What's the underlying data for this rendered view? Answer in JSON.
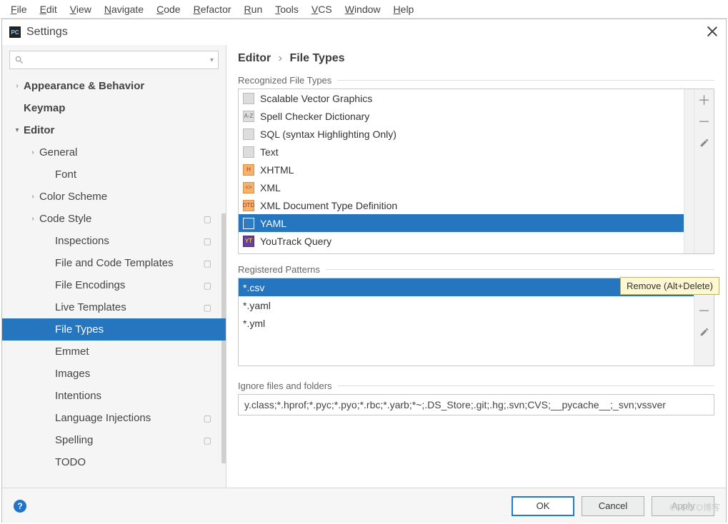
{
  "menubar": [
    "File",
    "Edit",
    "View",
    "Navigate",
    "Code",
    "Refactor",
    "Run",
    "Tools",
    "VCS",
    "Window",
    "Help"
  ],
  "dialog": {
    "title": "Settings"
  },
  "search": {
    "placeholder": ""
  },
  "tree": [
    {
      "label": "Appearance & Behavior",
      "bold": true,
      "arrow": "right",
      "indent": 0
    },
    {
      "label": "Keymap",
      "bold": true,
      "indent": 0,
      "noarrow": true
    },
    {
      "label": "Editor",
      "bold": true,
      "arrow": "down",
      "indent": 0
    },
    {
      "label": "General",
      "arrow": "right",
      "indent": 1
    },
    {
      "label": "Font",
      "indent": 2,
      "noarrow": true
    },
    {
      "label": "Color Scheme",
      "arrow": "right",
      "indent": 1
    },
    {
      "label": "Code Style",
      "arrow": "right",
      "indent": 1,
      "mark": true
    },
    {
      "label": "Inspections",
      "indent": 2,
      "noarrow": true,
      "mark": true
    },
    {
      "label": "File and Code Templates",
      "indent": 2,
      "noarrow": true,
      "mark": true
    },
    {
      "label": "File Encodings",
      "indent": 2,
      "noarrow": true,
      "mark": true
    },
    {
      "label": "Live Templates",
      "indent": 2,
      "noarrow": true,
      "mark": true
    },
    {
      "label": "File Types",
      "indent": 2,
      "noarrow": true,
      "selected": true
    },
    {
      "label": "Emmet",
      "indent": 2,
      "noarrow": true
    },
    {
      "label": "Images",
      "indent": 2,
      "noarrow": true
    },
    {
      "label": "Intentions",
      "indent": 2,
      "noarrow": true
    },
    {
      "label": "Language Injections",
      "indent": 2,
      "noarrow": true,
      "mark": true
    },
    {
      "label": "Spelling",
      "indent": 2,
      "noarrow": true,
      "mark": true
    },
    {
      "label": "TODO",
      "indent": 2,
      "noarrow": true
    }
  ],
  "breadcrumb": {
    "root": "Editor",
    "leaf": "File Types",
    "sep": "›"
  },
  "labels": {
    "recognized": "Recognized File Types",
    "patterns": "Registered Patterns",
    "ignore": "Ignore files and folders"
  },
  "filetypes": [
    {
      "name": "Scalable Vector Graphics",
      "icon": ""
    },
    {
      "name": "Spell Checker Dictionary",
      "icon": "A-Z"
    },
    {
      "name": "SQL (syntax Highlighting Only)",
      "icon": ""
    },
    {
      "name": "Text",
      "icon": ""
    },
    {
      "name": "XHTML",
      "icon": "H",
      "cls": "orange"
    },
    {
      "name": "XML",
      "icon": "<>",
      "cls": "orange"
    },
    {
      "name": "XML Document Type Definition",
      "icon": "DTD",
      "cls": "orange"
    },
    {
      "name": "YAML",
      "icon": "",
      "cls": "blue",
      "selected": true
    },
    {
      "name": "YouTrack Query",
      "icon": "YT",
      "cls": "purple"
    }
  ],
  "patterns": [
    {
      "value": "*.csv",
      "selected": true
    },
    {
      "value": "*.yaml"
    },
    {
      "value": "*.yml"
    }
  ],
  "ignore": "y.class;*.hprof;*.pyc;*.pyo;*.rbc;*.yarb;*~;.DS_Store;.git;.hg;.svn;CVS;__pycache__;_svn;vssver",
  "buttons": {
    "ok": "OK",
    "cancel": "Cancel",
    "apply": "Apply"
  },
  "tooltip": "Remove (Alt+Delete)"
}
